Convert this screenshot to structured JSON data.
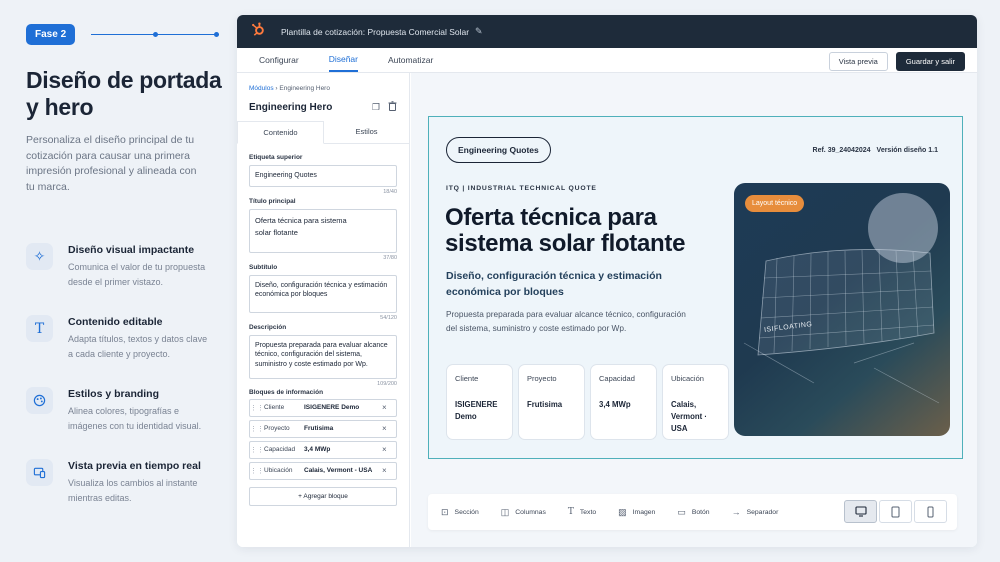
{
  "intro": {
    "phase": "Fase 2",
    "title": "Diseño de portada y hero",
    "description": "Personaliza el diseño principal de tu cotización para causar una primera impresión profesional y alineada con tu marca.",
    "features": [
      {
        "icon": "sparkle-icon",
        "title": "Diseño visual impactante",
        "desc": "Comunica el valor de tu propuesta desde el primer vistazo."
      },
      {
        "icon": "text-icon",
        "title": "Contenido editable",
        "desc": "Adapta títulos, textos y datos clave a cada cliente y proyecto."
      },
      {
        "icon": "palette-icon",
        "title": "Estilos y branding",
        "desc": "Alinea colores, tipografías e imágenes con tu identidad visual."
      },
      {
        "icon": "devices-icon",
        "title": "Vista previa en tiempo real",
        "desc": "Visualiza los cambios al instante mientras editas."
      }
    ]
  },
  "app": {
    "window_title": "Plantilla de cotización: Propuesta Comercial Solar",
    "tabs": [
      "Configurar",
      "Diseñar",
      "Automatizar"
    ],
    "active_tab": "Diseñar",
    "preview_label": "Vista previa",
    "save_label": "Guardar y salir"
  },
  "editor": {
    "breadcrumb_root": "Módulos",
    "breadcrumb_current": "Engineering Hero",
    "title": "Engineering Hero",
    "tabs": [
      "Contenido",
      "Estilos"
    ],
    "fields": {
      "eyebrow_label": "Etiqueta superior",
      "eyebrow_value": "Engineering Quotes",
      "eyebrow_count": "18/40",
      "title_label": "Título principal",
      "title_value": "Oferta técnica para sistema solar flotante",
      "title_count": "37/80",
      "subtitle_label": "Subtítulo",
      "subtitle_value": "Diseño, configuración técnica y estimación económica por bloques",
      "subtitle_count": "54/120",
      "desc_label": "Descripción",
      "desc_value": "Propuesta preparada para evaluar alcance técnico, configuración del sistema, suministro y coste estimado por Wp.",
      "desc_count": "109/200"
    },
    "blocks_label": "Bloques de información",
    "blocks": [
      {
        "key": "Cliente",
        "value": "ISIGENERE Demo"
      },
      {
        "key": "Proyecto",
        "value": "Frutisima"
      },
      {
        "key": "Capacidad",
        "value": "3,4 MWp"
      },
      {
        "key": "Ubicación",
        "value": "Calais, Vermont - USA"
      }
    ],
    "add_block_label": "+ Agregar bloque"
  },
  "hero": {
    "pill": "Engineering Quotes",
    "ref": "Ref. 39_24042024",
    "version": "Versión diseño 1.1",
    "eyebrow": "ITQ | INDUSTRIAL TECHNICAL QUOTE",
    "title": "Oferta técnica para sistema solar flotante",
    "subtitle": "Diseño, configuración técnica y estimación económica por bloques",
    "description": "Propuesta preparada para evaluar alcance técnico, configuración del sistema, suministro y coste estimado por Wp.",
    "cards": [
      {
        "label": "Cliente",
        "value": "ISIGENERE Demo"
      },
      {
        "label": "Proyecto",
        "value": "Frutisima"
      },
      {
        "label": "Capacidad",
        "value": "3,4 MWp"
      },
      {
        "label": "Ubicación",
        "value": "Calais, Vermont · USA"
      }
    ],
    "visual_badge": "Layout técnico",
    "visual_label": "ISIFLOATING"
  },
  "toolbar": {
    "tools": [
      {
        "icon": "section-icon",
        "label": "Sección"
      },
      {
        "icon": "columns-icon",
        "label": "Columnas"
      },
      {
        "icon": "text-tool-icon",
        "label": "Texto"
      },
      {
        "icon": "image-icon",
        "label": "Imagen"
      },
      {
        "icon": "button-icon",
        "label": "Botón"
      },
      {
        "icon": "separator-icon",
        "label": "Separador"
      }
    ],
    "devices": [
      "desktop-icon",
      "tablet-icon",
      "mobile-icon"
    ],
    "active_device": "desktop-icon"
  },
  "colors": {
    "accent": "#1f6fd6",
    "dark": "#1e2b3a",
    "hero_border": "#4fb0ba",
    "badge": "#e78d3c"
  }
}
